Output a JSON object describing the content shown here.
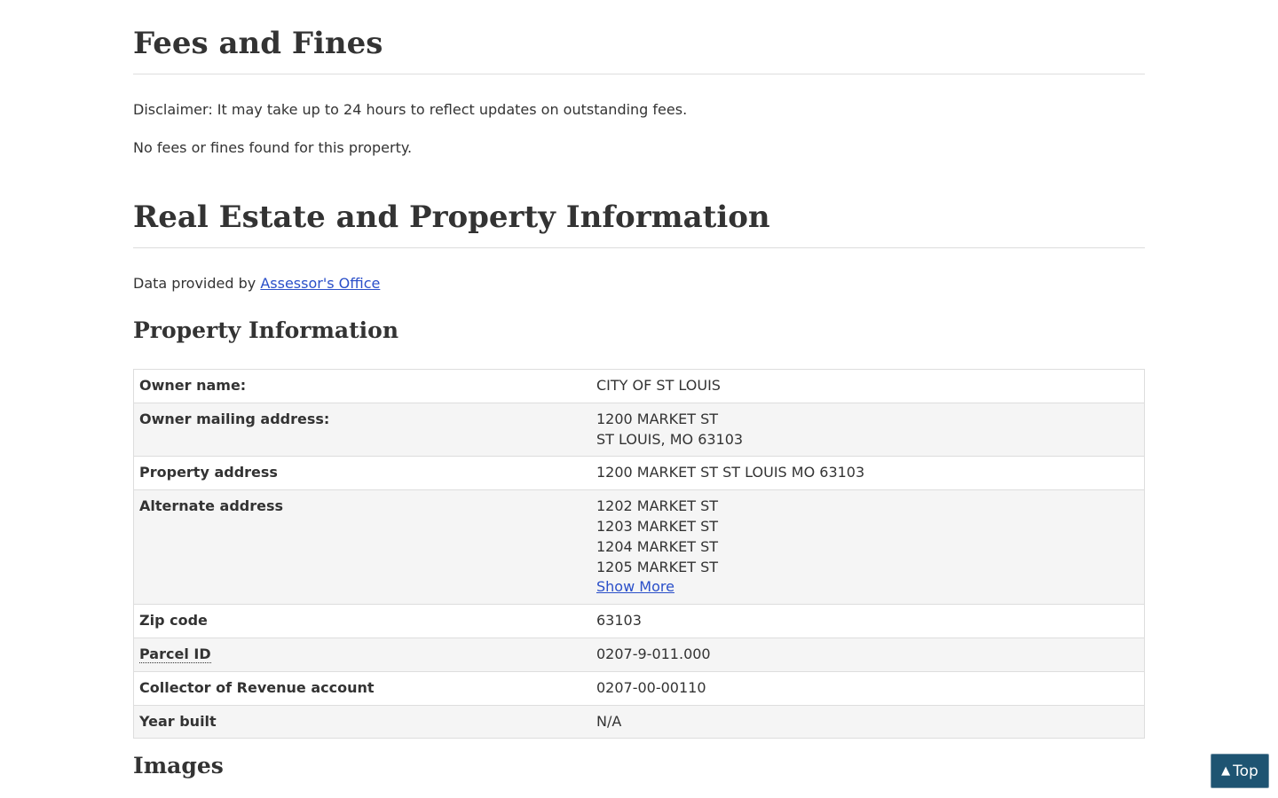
{
  "fees": {
    "title": "Fees and Fines",
    "disclaimer": "Disclaimer: It may take up to 24 hours to reflect updates on outstanding fees.",
    "none_found": "No fees or fines found for this property."
  },
  "real_estate": {
    "title": "Real Estate and Property Information",
    "provided_prefix": "Data provided by ",
    "provider_link": "Assessor's Office"
  },
  "property_info": {
    "title": "Property Information",
    "rows": {
      "owner_name": {
        "label": "Owner name:",
        "value": "CITY OF ST LOUIS"
      },
      "owner_mailing": {
        "label": "Owner mailing address:",
        "line1": "1200 MARKET ST",
        "line2": "ST LOUIS, MO 63103"
      },
      "property_address": {
        "label": "Property address",
        "value": "1200 MARKET ST ST LOUIS MO 63103"
      },
      "alternate_address": {
        "label": "Alternate address",
        "values": [
          "1202 MARKET ST",
          "1203 MARKET ST",
          "1204 MARKET ST",
          "1205 MARKET ST"
        ],
        "show_more": "Show More"
      },
      "zip_code": {
        "label": "Zip code",
        "value": "63103"
      },
      "parcel_id": {
        "label": "Parcel ID",
        "value": "0207-9-011.000"
      },
      "collector_account": {
        "label": "Collector of Revenue account",
        "value": "0207-00-00110"
      },
      "year_built": {
        "label": "Year built",
        "value": "N/A"
      }
    }
  },
  "images": {
    "title": "Images"
  },
  "top_button": {
    "arrow": "▲",
    "label": "Top"
  }
}
